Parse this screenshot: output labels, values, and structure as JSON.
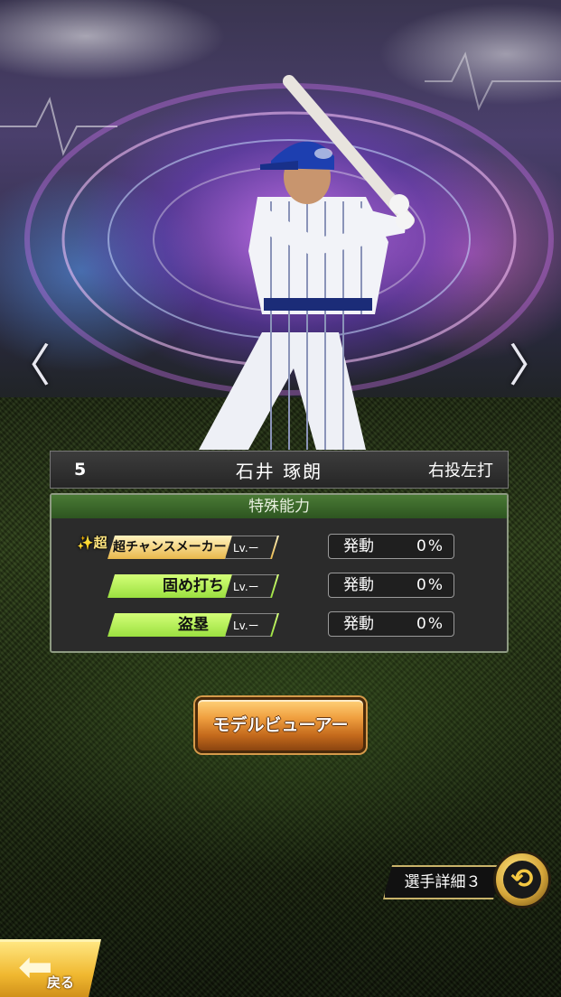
{
  "player": {
    "number": "5",
    "name": "石井 琢朗",
    "throw_bat": "右投左打"
  },
  "abilities": {
    "header": "特殊能力",
    "items": [
      {
        "badge": "✨超",
        "name": "超チャンスメーカー",
        "level": "Lv.ー",
        "rate_label": "発動",
        "rate": "0%",
        "tier": "gold"
      },
      {
        "badge": "",
        "name": "固め打ち",
        "level": "Lv.ー",
        "rate_label": "発動",
        "rate": "0%",
        "tier": "green"
      },
      {
        "badge": "",
        "name": "盗塁",
        "level": "Lv.ー",
        "rate_label": "発動",
        "rate": "0%",
        "tier": "green"
      }
    ]
  },
  "buttons": {
    "model_viewer": "モデルビューアー",
    "player_detail": "選手詳細３",
    "back": "戻る"
  },
  "nav": {
    "prev": "〈",
    "next": "〉"
  },
  "icons": {
    "swap": "swap-icon",
    "back": "back-arrow-icon"
  }
}
